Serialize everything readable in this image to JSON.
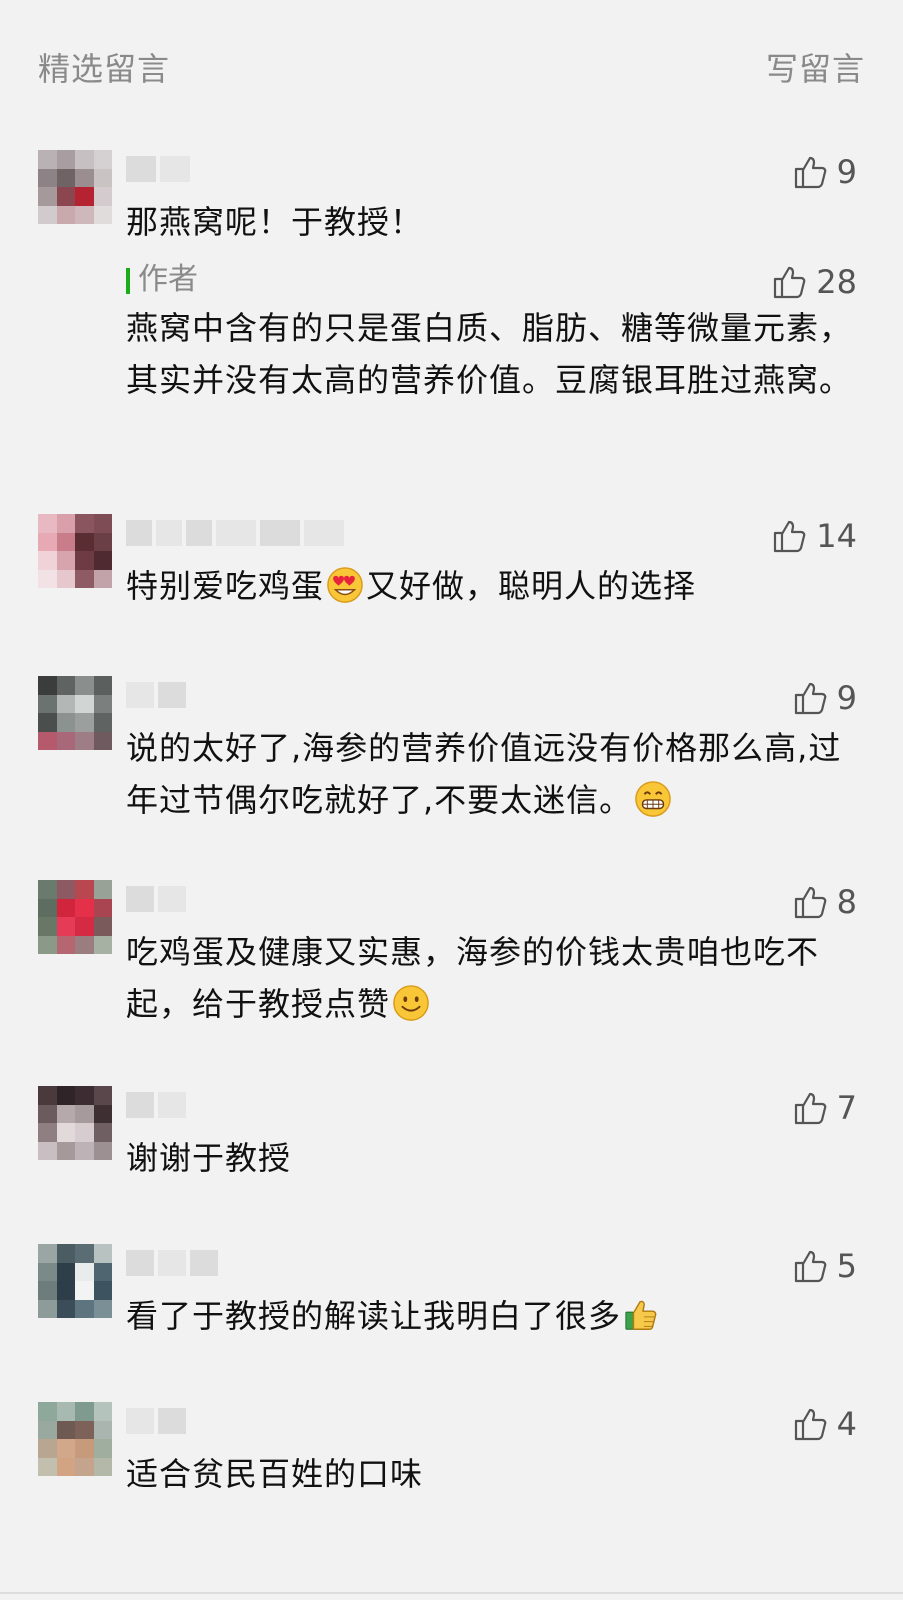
{
  "header": {
    "title": "精选留言",
    "write_label": "写留言"
  },
  "comments": [
    {
      "likes": "9",
      "text": "那燕窝呢！于教授！",
      "reply": {
        "label": "作者",
        "likes": "28",
        "text": "燕窝中含有的只是蛋白质、脂肪、糖等微量元素，其实并没有太高的营养价值。豆腐银耳胜过燕窝。"
      }
    },
    {
      "likes": "14",
      "text_before_emoji": "特别爱吃鸡蛋",
      "emoji": "heart-eyes-emoji",
      "text_after_emoji": "又好做，聪明人的选择"
    },
    {
      "likes": "9",
      "text_before_emoji": "说的太好了,海参的营养价值远没有价格那么高,过年过节偶尔吃就好了,不要太迷信。",
      "emoji": "grin-emoji",
      "text_after_emoji": ""
    },
    {
      "likes": "8",
      "text_before_emoji": "吃鸡蛋及健康又实惠，海参的价钱太贵咱也吃不起，给于教授点赞",
      "emoji": "smile-emoji",
      "text_after_emoji": ""
    },
    {
      "likes": "7",
      "text": "谢谢于教授"
    },
    {
      "likes": "5",
      "text_before_emoji": "看了于教授的解读让我明白了很多",
      "emoji": "thumbs-up-emoji",
      "text_after_emoji": ""
    },
    {
      "likes": "4",
      "text": "适合贫民百姓的口味"
    }
  ],
  "colors": {
    "background": "#f2f2f2",
    "muted_text": "#8a8a8a",
    "author_accent": "#1aad19"
  }
}
